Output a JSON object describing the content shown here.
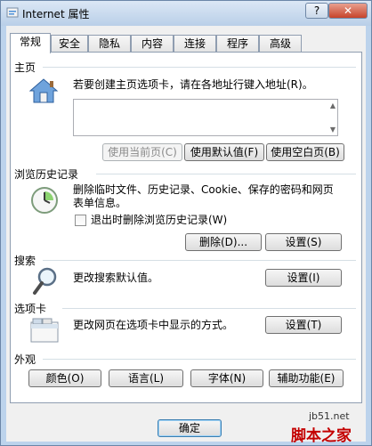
{
  "window": {
    "title": "Internet 属性",
    "help_label": "?",
    "close_label": "✕"
  },
  "tabs": [
    {
      "label": "常规"
    },
    {
      "label": "安全"
    },
    {
      "label": "隐私"
    },
    {
      "label": "内容"
    },
    {
      "label": "连接"
    },
    {
      "label": "程序"
    },
    {
      "label": "高级"
    }
  ],
  "home": {
    "title": "主页",
    "description": "若要创建主页选项卡，请在各地址行键入地址(R)。",
    "address_value": "",
    "use_current_label": "使用当前页(C)",
    "use_default_label": "使用默认值(F)",
    "use_blank_label": "使用空白页(B)"
  },
  "history": {
    "title": "浏览历史记录",
    "description_line1": "删除临时文件、历史记录、Cookie、保存的密码和网页",
    "description_line2": "表单信息。",
    "checkbox_label": "退出时删除浏览历史记录(W)",
    "delete_label": "删除(D)...",
    "settings_label": "设置(S)"
  },
  "search": {
    "title": "搜索",
    "description": "更改搜索默认值。",
    "settings_label": "设置(I)"
  },
  "tabs_group": {
    "title": "选项卡",
    "description": "更改网页在选项卡中显示的方式。",
    "settings_label": "设置(T)"
  },
  "appearance": {
    "title": "外观",
    "colors_label": "颜色(O)",
    "languages_label": "语言(L)",
    "fonts_label": "字体(N)",
    "accessibility_label": "辅助功能(E)"
  },
  "footer": {
    "ok_label": "确定"
  },
  "watermark": {
    "site": "jb51.net",
    "name": "脚本之家"
  },
  "colors": {
    "accent": "#3c7fb1",
    "panel": "#ffffff",
    "frame": "#bcd3ec"
  }
}
